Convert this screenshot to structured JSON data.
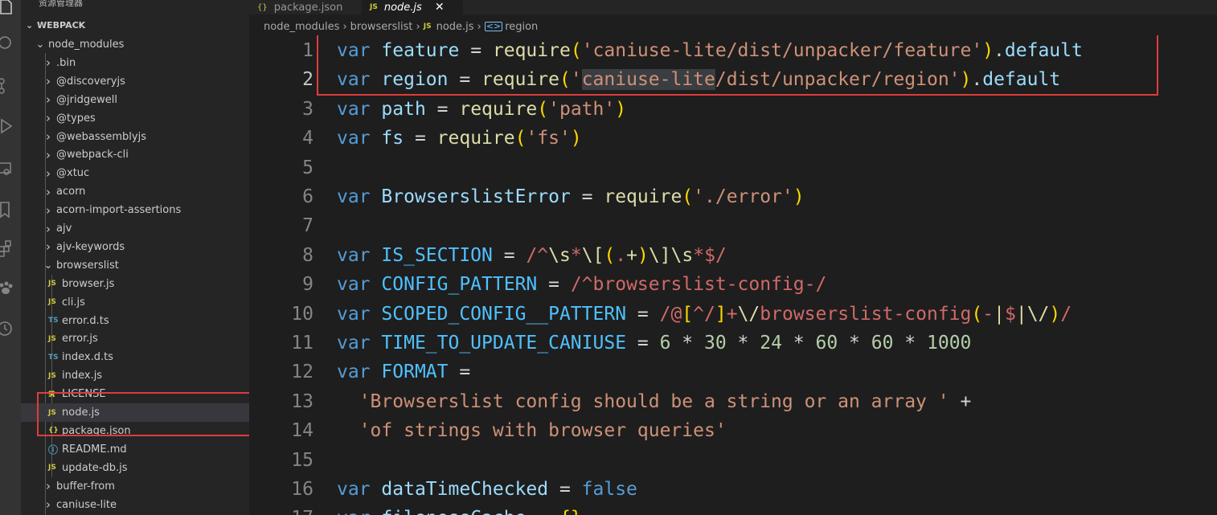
{
  "sidebar": {
    "title": "资源管理器",
    "more": "···",
    "section": "WEBPACK",
    "items": [
      {
        "label": "node_modules",
        "icon": "chevron-down-icon",
        "kind": "folder-open",
        "depth": 0
      },
      {
        "label": ".bin",
        "icon": "chevron-right-icon",
        "kind": "folder",
        "depth": 1
      },
      {
        "label": "@discoveryjs",
        "icon": "chevron-right-icon",
        "kind": "folder",
        "depth": 1
      },
      {
        "label": "@jridgewell",
        "icon": "chevron-right-icon",
        "kind": "folder",
        "depth": 1
      },
      {
        "label": "@types",
        "icon": "chevron-right-icon",
        "kind": "folder",
        "depth": 1
      },
      {
        "label": "@webassemblyjs",
        "icon": "chevron-right-icon",
        "kind": "folder",
        "depth": 1
      },
      {
        "label": "@webpack-cli",
        "icon": "chevron-right-icon",
        "kind": "folder",
        "depth": 1
      },
      {
        "label": "@xtuc",
        "icon": "chevron-right-icon",
        "kind": "folder",
        "depth": 1
      },
      {
        "label": "acorn",
        "icon": "chevron-right-icon",
        "kind": "folder",
        "depth": 1
      },
      {
        "label": "acorn-import-assertions",
        "icon": "chevron-right-icon",
        "kind": "folder",
        "depth": 1
      },
      {
        "label": "ajv",
        "icon": "chevron-right-icon",
        "kind": "folder",
        "depth": 1
      },
      {
        "label": "ajv-keywords",
        "icon": "chevron-right-icon",
        "kind": "folder",
        "depth": 1
      },
      {
        "label": "browserslist",
        "icon": "chevron-down-icon",
        "kind": "folder-open",
        "depth": 1
      },
      {
        "label": "browser.js",
        "icon": "JS",
        "kind": "js",
        "depth": 2
      },
      {
        "label": "cli.js",
        "icon": "JS",
        "kind": "js",
        "depth": 2
      },
      {
        "label": "error.d.ts",
        "icon": "TS",
        "kind": "ts",
        "depth": 2
      },
      {
        "label": "error.js",
        "icon": "JS",
        "kind": "js",
        "depth": 2
      },
      {
        "label": "index.d.ts",
        "icon": "TS",
        "kind": "ts",
        "depth": 2
      },
      {
        "label": "index.js",
        "icon": "JS",
        "kind": "js",
        "depth": 2
      },
      {
        "label": "LICENSE",
        "icon": "license-icon",
        "kind": "lic",
        "depth": 2
      },
      {
        "label": "node.js",
        "icon": "JS",
        "kind": "js",
        "depth": 2,
        "selected": true
      },
      {
        "label": "package.json",
        "icon": "{}",
        "kind": "json",
        "depth": 2
      },
      {
        "label": "README.md",
        "icon": "info-icon",
        "kind": "info",
        "depth": 2
      },
      {
        "label": "update-db.js",
        "icon": "JS",
        "kind": "js",
        "depth": 2
      },
      {
        "label": "buffer-from",
        "icon": "chevron-right-icon",
        "kind": "folder",
        "depth": 1
      },
      {
        "label": "caniuse-lite",
        "icon": "chevron-right-icon",
        "kind": "folder",
        "depth": 1
      }
    ]
  },
  "tabs": [
    {
      "label": "package.json",
      "icon": "json-icon",
      "active": false
    },
    {
      "label": "node.js",
      "icon": "JS",
      "active": true,
      "close": "✕"
    }
  ],
  "breadcrumb": {
    "parts": [
      "node_modules",
      "browserslist",
      "node.js",
      "region"
    ],
    "separator": "›"
  },
  "editor": {
    "current_line": 2,
    "lines": [
      [
        [
          "kw",
          "var"
        ],
        [
          "p",
          " "
        ],
        [
          "v",
          "feature"
        ],
        [
          "p",
          " = "
        ],
        [
          "fn",
          "require"
        ],
        [
          "p1",
          "("
        ],
        [
          "st",
          "'caniuse-lite/dist/unpacker/feature'"
        ],
        [
          "p1",
          ")"
        ],
        [
          "p",
          "."
        ],
        [
          "v",
          "default"
        ]
      ],
      [
        [
          "kw",
          "var"
        ],
        [
          "p",
          " "
        ],
        [
          "v",
          "region"
        ],
        [
          "p",
          " = "
        ],
        [
          "fn",
          "require"
        ],
        [
          "p1",
          "("
        ],
        [
          "st",
          "'"
        ],
        [
          "sthl",
          "caniuse-lite"
        ],
        [
          "st",
          "/dist/unpacker/region'"
        ],
        [
          "p1",
          ")"
        ],
        [
          "p",
          "."
        ],
        [
          "v",
          "default"
        ]
      ],
      [
        [
          "kw",
          "var"
        ],
        [
          "p",
          " "
        ],
        [
          "v",
          "path"
        ],
        [
          "p",
          " = "
        ],
        [
          "fn",
          "require"
        ],
        [
          "p1",
          "("
        ],
        [
          "st",
          "'path'"
        ],
        [
          "p1",
          ")"
        ]
      ],
      [
        [
          "kw",
          "var"
        ],
        [
          "p",
          " "
        ],
        [
          "v",
          "fs"
        ],
        [
          "p",
          " = "
        ],
        [
          "fn",
          "require"
        ],
        [
          "p1",
          "("
        ],
        [
          "st",
          "'fs'"
        ],
        [
          "p1",
          ")"
        ]
      ],
      [],
      [
        [
          "kw",
          "var"
        ],
        [
          "p",
          " "
        ],
        [
          "v",
          "BrowserslistError"
        ],
        [
          "p",
          " = "
        ],
        [
          "fn",
          "require"
        ],
        [
          "p1",
          "("
        ],
        [
          "st",
          "'./error'"
        ],
        [
          "p1",
          ")"
        ]
      ],
      [],
      [
        [
          "kw",
          "var"
        ],
        [
          "p",
          " "
        ],
        [
          "cv",
          "IS_SECTION"
        ],
        [
          "p",
          " = "
        ],
        [
          "rx",
          "/^"
        ],
        [
          "fn",
          "\\s"
        ],
        [
          "rx",
          "*"
        ],
        [
          "fn",
          "\\["
        ],
        [
          "p1",
          "("
        ],
        [
          "rx",
          "."
        ],
        [
          "fn",
          "+"
        ],
        [
          "p1",
          ")"
        ],
        [
          "fn",
          "\\]"
        ],
        [
          "fn",
          "\\s"
        ],
        [
          "rx",
          "*$/"
        ]
      ],
      [
        [
          "kw",
          "var"
        ],
        [
          "p",
          " "
        ],
        [
          "cv",
          "CONFIG_PATTERN"
        ],
        [
          "p",
          " = "
        ],
        [
          "rx",
          "/^browserslist-config-/"
        ]
      ],
      [
        [
          "kw",
          "var"
        ],
        [
          "p",
          " "
        ],
        [
          "cv",
          "SCOPED_CONFIG__PATTERN"
        ],
        [
          "p",
          " = "
        ],
        [
          "rx",
          "/@"
        ],
        [
          "p1",
          "["
        ],
        [
          "rx",
          "^/"
        ],
        [
          "p1",
          "]"
        ],
        [
          "rx",
          "+"
        ],
        [
          "fn",
          "\\/"
        ],
        [
          "rx",
          "browserslist-config"
        ],
        [
          "p1",
          "("
        ],
        [
          "rx",
          "-"
        ],
        [
          "fn",
          "|"
        ],
        [
          "rx",
          "$"
        ],
        [
          "fn",
          "|"
        ],
        [
          "fn",
          "\\/"
        ],
        [
          "p1",
          ")"
        ],
        [
          "rx",
          "/"
        ]
      ],
      [
        [
          "kw",
          "var"
        ],
        [
          "p",
          " "
        ],
        [
          "cv",
          "TIME_TO_UPDATE_CANIUSE"
        ],
        [
          "p",
          " = "
        ],
        [
          "nm",
          "6"
        ],
        [
          "p",
          " * "
        ],
        [
          "nm",
          "30"
        ],
        [
          "p",
          " * "
        ],
        [
          "nm",
          "24"
        ],
        [
          "p",
          " * "
        ],
        [
          "nm",
          "60"
        ],
        [
          "p",
          " * "
        ],
        [
          "nm",
          "60"
        ],
        [
          "p",
          " * "
        ],
        [
          "nm",
          "1000"
        ]
      ],
      [
        [
          "kw",
          "var"
        ],
        [
          "p",
          " "
        ],
        [
          "cv",
          "FORMAT"
        ],
        [
          "p",
          " ="
        ]
      ],
      [
        [
          "p",
          "  "
        ],
        [
          "st",
          "'Browserslist config should be a string or an array '"
        ],
        [
          "p",
          " +"
        ]
      ],
      [
        [
          "p",
          "  "
        ],
        [
          "st",
          "'of strings with browser queries'"
        ]
      ],
      [],
      [
        [
          "kw",
          "var"
        ],
        [
          "p",
          " "
        ],
        [
          "v",
          "dataTimeChecked"
        ],
        [
          "p",
          " = "
        ],
        [
          "kw",
          "false"
        ]
      ],
      [
        [
          "kw",
          "var"
        ],
        [
          "p",
          " "
        ],
        [
          "v",
          "filenessCache"
        ],
        [
          "p",
          " = "
        ],
        [
          "p1",
          "{}"
        ]
      ]
    ]
  },
  "annotation_color": "#e03c3c"
}
